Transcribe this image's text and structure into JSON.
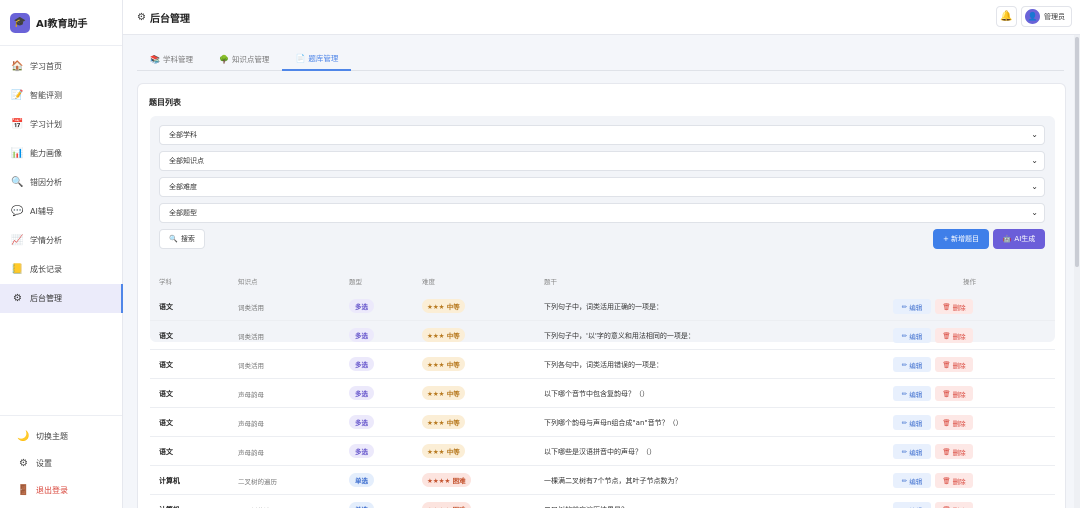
{
  "app": {
    "name": "AI教育助手",
    "logo": "graduation-cap-icon"
  },
  "sidebar": {
    "items": [
      {
        "label": "学习首页",
        "icon": "🏠",
        "name": "home"
      },
      {
        "label": "智能评测",
        "icon": "📝",
        "name": "assessment"
      },
      {
        "label": "学习计划",
        "icon": "📅",
        "name": "plan"
      },
      {
        "label": "能力画像",
        "icon": "📊",
        "name": "profile"
      },
      {
        "label": "错因分析",
        "icon": "🔍",
        "name": "error-analysis"
      },
      {
        "label": "AI辅导",
        "icon": "💬",
        "name": "ai-tutor"
      },
      {
        "label": "学情分析",
        "icon": "📈",
        "name": "learning-analysis"
      },
      {
        "label": "成长记录",
        "icon": "📒",
        "name": "growth"
      },
      {
        "label": "后台管理",
        "icon": "⚙",
        "name": "admin"
      }
    ],
    "bottom": [
      {
        "label": "切换主题",
        "icon": "🌙"
      },
      {
        "label": "设置",
        "icon": "⚙"
      },
      {
        "label": "退出登录",
        "icon": "🚪"
      }
    ]
  },
  "topbar": {
    "title": "后台管理",
    "user": "管理员"
  },
  "tabs": [
    {
      "label": "学科管理",
      "icon": "📚"
    },
    {
      "label": "知识点管理",
      "icon": "🌳"
    },
    {
      "label": "题库管理",
      "icon": "📄"
    }
  ],
  "list": {
    "title": "题目列表",
    "filters": [
      "全部学科",
      "全部知识点",
      "全部难度",
      "全部题型"
    ],
    "search": "搜索",
    "add": "+ 新增题目",
    "ai": "AI生成",
    "headers": [
      "学科",
      "知识点",
      "题型",
      "难度",
      "题干",
      "操作"
    ],
    "edit": "编辑",
    "delete": "删除",
    "rows": [
      {
        "subject": "语文",
        "kp": "词类活用",
        "type": "多选",
        "diff": "★★★ 中等",
        "stem": "下列句子中，词类活用正确的一项是："
      },
      {
        "subject": "语文",
        "kp": "词类活用",
        "type": "多选",
        "diff": "★★★ 中等",
        "stem": "下列句子中，'以'字的意义和用法相同的一项是："
      },
      {
        "subject": "语文",
        "kp": "词类活用",
        "type": "多选",
        "diff": "★★★ 中等",
        "stem": "下列各句中，词类活用错误的一项是："
      },
      {
        "subject": "语文",
        "kp": "声母韵母",
        "type": "多选",
        "diff": "★★★ 中等",
        "stem": "以下哪个音节中包含复韵母？（）"
      },
      {
        "subject": "语文",
        "kp": "声母韵母",
        "type": "多选",
        "diff": "★★★ 中等",
        "stem": "下列哪个韵母与声母n组合成\"an\"音节？（）"
      },
      {
        "subject": "语文",
        "kp": "声母韵母",
        "type": "多选",
        "diff": "★★★ 中等",
        "stem": "以下哪些是汉语拼音中的声母？（）"
      },
      {
        "subject": "计算机",
        "kp": "二叉树的遍历",
        "type": "单选",
        "diff": "★★★★ 困难",
        "stem": "一棵满二叉树有7个节点，其叶子节点数为？"
      },
      {
        "subject": "计算机",
        "kp": "二叉树的遍历",
        "type": "单选",
        "diff": "★★★★ 困难",
        "stem": "二叉树的前序遍历结果是？"
      }
    ]
  }
}
